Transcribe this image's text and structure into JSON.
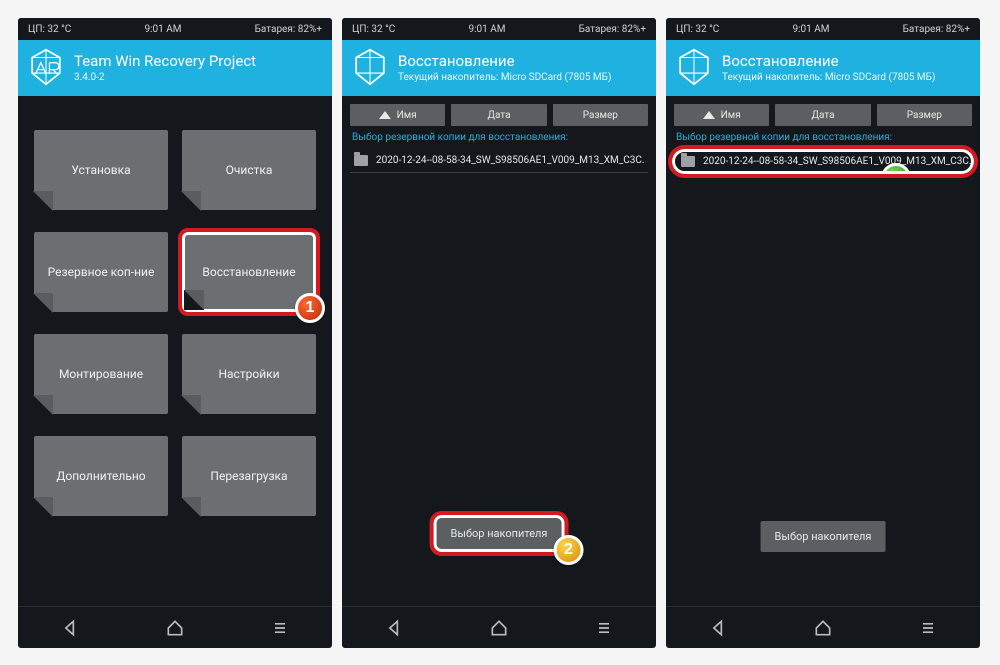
{
  "status": {
    "cpu": "ЦП: 32 °C",
    "time": "9:01 AM",
    "battery": "Батарея: 82%+"
  },
  "screen1": {
    "title": "Team Win Recovery Project",
    "version": "3.4.0-2",
    "tiles": {
      "install": "Установка",
      "wipe": "Очистка",
      "backup": "Резервное коп-ние",
      "restore": "Восстановление",
      "mount": "Монтирование",
      "settings": "Настройки",
      "advanced": "Дополнительно",
      "reboot": "Перезагрузка"
    }
  },
  "screen2": {
    "title": "Восстановление",
    "storage": "Текущий накопитель: Micro SDCard (7805 МБ)",
    "sort": {
      "name": "Имя",
      "date": "Дата",
      "size": "Размер"
    },
    "listlabel": "Выбор резервной копии для восстановления:",
    "item": "2020-12-24--08-58-34_SW_S98506AE1_V009_M13_XM_C3C.",
    "item_hl": "2020-12-24--08-58-34_SW_S98506AE1_V009_M13_XM_C3C.",
    "select_storage": "Выбор накопителя"
  }
}
